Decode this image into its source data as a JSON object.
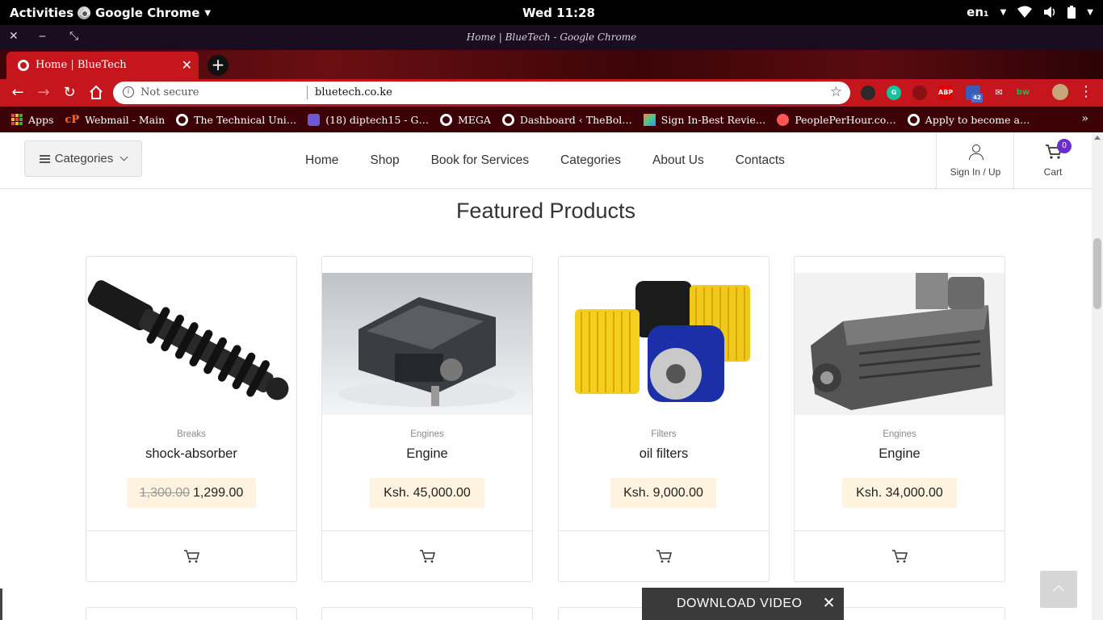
{
  "gnome": {
    "activities": "Activities",
    "app_name": "Google Chrome",
    "clock": "Wed 11:28",
    "lang": "en₁"
  },
  "window": {
    "title": "Home | BlueTech - Google Chrome"
  },
  "tab": {
    "title": "Home | BlueTech",
    "new_tab": "+"
  },
  "omnibox": {
    "security": "Not secure",
    "url": "bluetech.co.ke"
  },
  "extensions": {
    "abp": "ABP",
    "count": "42",
    "bw": "bw"
  },
  "bookmarks": [
    "Apps",
    "Webmail - Main",
    "The Technical Uni…",
    "(18) diptech15 - G…",
    "MEGA",
    "Dashboard ‹ TheBol…",
    "Sign In-Best Revie…",
    "PeoplePerHour.co…",
    "Apply to become a…"
  ],
  "header": {
    "categories_btn": "Categories",
    "nav": [
      "Home",
      "Shop",
      "Book for Services",
      "Categories",
      "About Us",
      "Contacts"
    ],
    "signin": "Sign In / Up",
    "cart": "Cart",
    "cart_count": "0"
  },
  "section_title": "Featured Products",
  "products": [
    {
      "category": "Breaks",
      "name": "shock-absorber",
      "old_price": "1,300.00",
      "price": "1,299.00"
    },
    {
      "category": "Engines",
      "name": "Engine",
      "price": "Ksh. 45,000.00"
    },
    {
      "category": "Filters",
      "name": "oil filters",
      "price": "Ksh. 9,000.00"
    },
    {
      "category": "Engines",
      "name": "Engine",
      "price": "Ksh. 34,000.00"
    }
  ],
  "download_bar": {
    "label": "DOWNLOAD VIDEO",
    "close": "✕"
  },
  "colors": {
    "chrome_theme": "#c4161c",
    "bookmark_bar": "#3c0206",
    "cart_badge": "#6c2ec9",
    "price_bg": "#fdf3de"
  }
}
